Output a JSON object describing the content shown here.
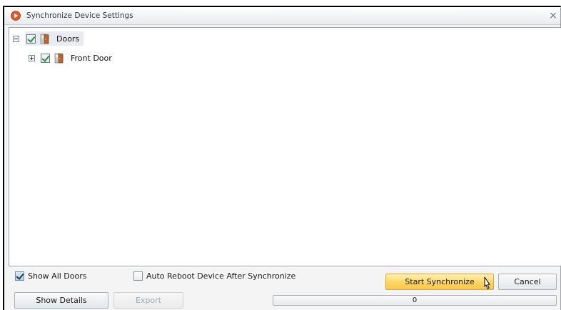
{
  "window": {
    "title": "Synchronize Device Settings",
    "close_glyph": "×"
  },
  "tree": {
    "root": {
      "label": "Doors",
      "expanded": true,
      "checked": true,
      "icon": "door-icon"
    },
    "children": [
      {
        "label": "Front Door",
        "expanded": false,
        "checked": true,
        "icon": "door-icon"
      }
    ]
  },
  "options": {
    "show_all_doors": {
      "label": "Show All Doors",
      "checked": true
    },
    "auto_reboot": {
      "label": "Auto Reboot Device After Synchronize",
      "checked": false
    }
  },
  "buttons": {
    "start_synchronize": "Start Synchronize",
    "cancel": "Cancel",
    "show_details": "Show Details",
    "export": "Export"
  },
  "progress": {
    "value": 0,
    "label": "0"
  },
  "colors": {
    "primary_button": "#fcd663",
    "app_icon": "#e2572b"
  }
}
